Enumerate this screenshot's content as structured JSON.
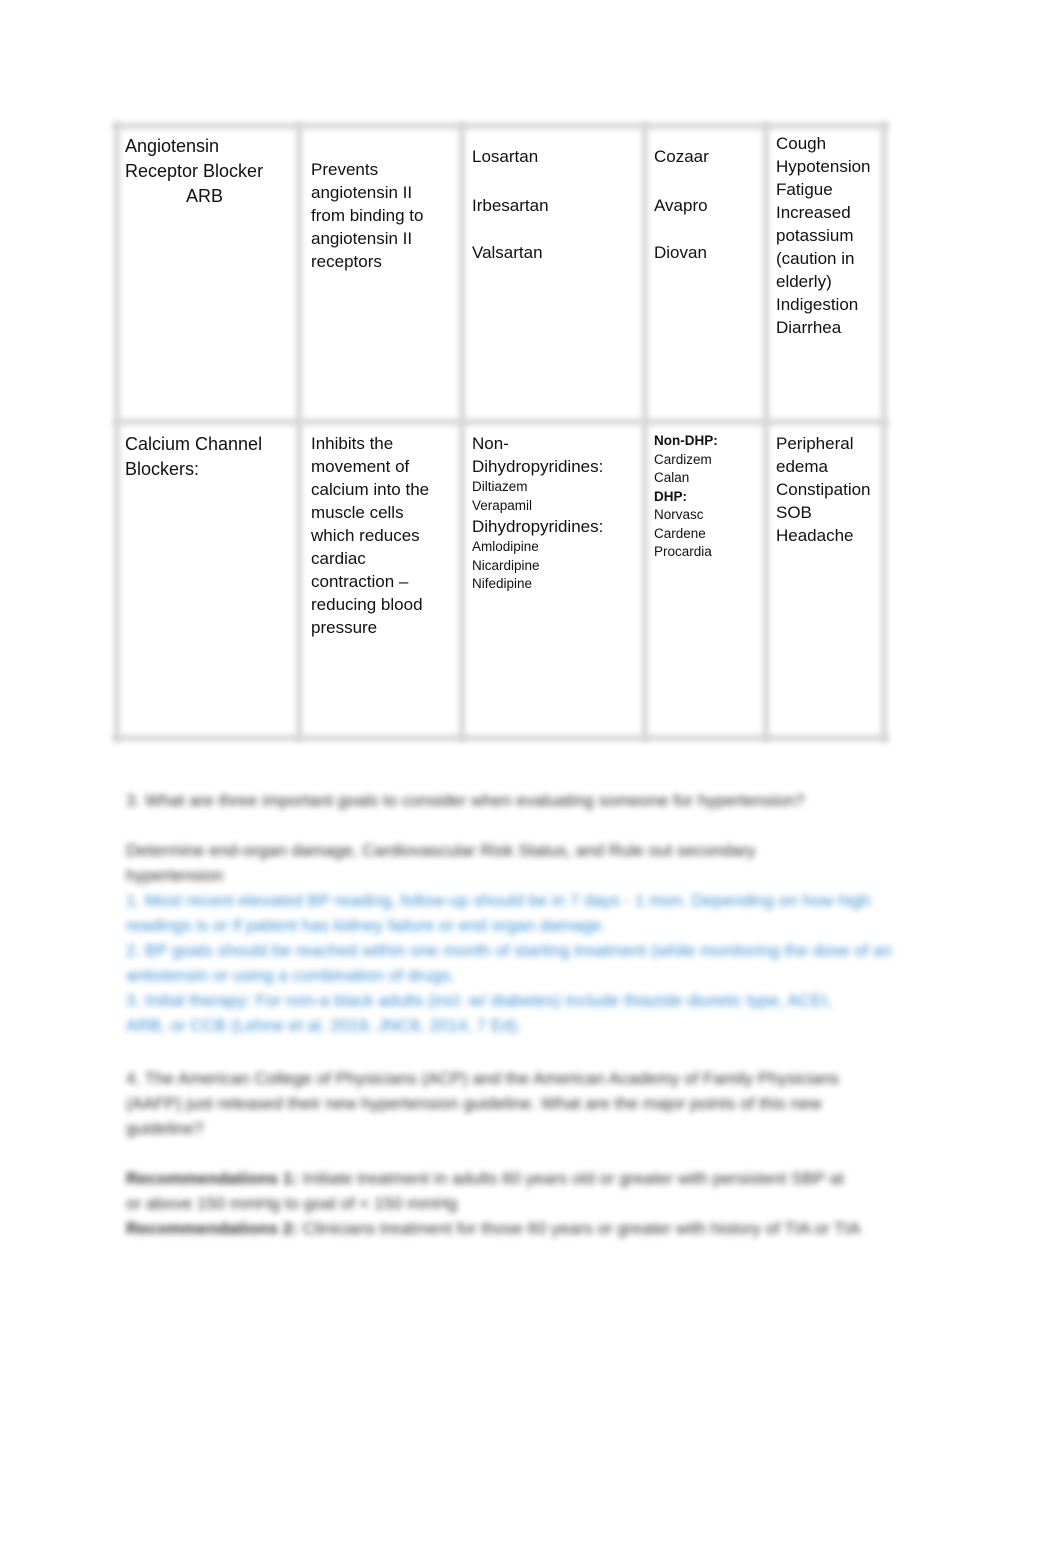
{
  "table": {
    "rows": [
      {
        "class_name": [
          "Angiotensin",
          "Receptor Blocker",
          "ARB"
        ],
        "mechanism": [
          "Prevents",
          "angiotensin II",
          "from binding to",
          "angiotensin II",
          "receptors"
        ],
        "generic": [
          "Losartan",
          "Irbesartan",
          "Valsartan"
        ],
        "brand": [
          "Cozaar",
          "Avapro",
          "Diovan"
        ],
        "side_effects": [
          "Cough",
          "Hypotension",
          "Fatigue",
          "Increased",
          "potassium",
          "(caution in",
          "elderly)",
          "Indigestion",
          "Diarrhea"
        ]
      },
      {
        "class_name": [
          "Calcium Channel",
          "Blockers:"
        ],
        "mechanism": [
          "Inhibits the",
          "movement of",
          "calcium into the",
          "muscle cells",
          "which reduces",
          "cardiac",
          "contraction –",
          "reducing blood",
          "pressure"
        ],
        "generic": {
          "group1_label": [
            "Non-",
            "Dihydropyridines:"
          ],
          "group1_items": [
            "Diltiazem",
            "Verapamil"
          ],
          "group2_label": "Dihydropyridines:",
          "group2_items": [
            "Amlodipine",
            "Nicardipine",
            "Nifedipine"
          ]
        },
        "brand": {
          "group1_label": "Non-DHP:",
          "group1_items": [
            "Cardizem",
            "Calan"
          ],
          "group2_label": "DHP:",
          "group2_items": [
            "Norvasc",
            "Cardene",
            "Procardia"
          ]
        },
        "side_effects": [
          "Peripheral",
          "edema",
          "Constipation",
          "SOB",
          "Headache"
        ]
      }
    ]
  },
  "blurred": {
    "q3": "3.   What are three important goals to consider when evaluating someone for hypertension?",
    "a3": [
      "Determine end-organ damage, Cardiovascular Risk Status, and Rule out secondary",
      "hypertension"
    ],
    "a3_links": [
      [
        "1.     Most recent elevated BP reading, follow-up should be in 7 days - 1 mon. Depending on how high",
        "readings is or if patient has kidney failure or end organ damage."
      ],
      [
        "2.     BP goals should be reached within one month of starting treatment (while monitoring the dose of an",
        "antiotensin or using a combination of drugs."
      ],
      [
        "3.     Initial therapy: For non-a black adults (incl. w/ diabetes) include thiazide diuretic type, ACEI,",
        "ARB, or CCB (Lehne et al. 2019, JNC8, 2014, 7 Ed)."
      ]
    ],
    "q4": [
      "4.   The American College of Physicians (ACP) and the American Academy of Family Physicians",
      "(AAFP) just released their new hypertension guideline. What are the major points of this new",
      "guideline?"
    ],
    "a4": [
      [
        "Recommendations 1:",
        " Initiate treatment in adults 60 years old or greater with persistent SBP at"
      ],
      [
        "",
        "or above 150 mmHg to goal of < 150 mmHg"
      ],
      [
        "Recommendations 2:",
        " Clinicians treatment for those 60 years or greater with history of TIA or TIA"
      ]
    ]
  }
}
